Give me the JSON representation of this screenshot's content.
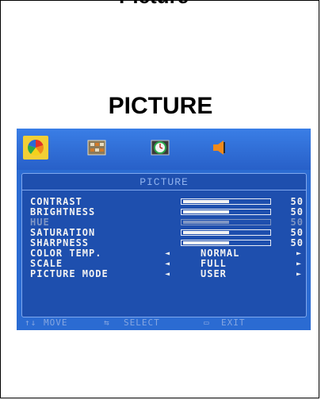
{
  "heading_cut": "Picture",
  "section_title": "PICTURE",
  "osd": {
    "tabs": [
      {
        "name": "picture",
        "icon": "color-wheel-icon",
        "active": true
      },
      {
        "name": "settings",
        "icon": "settings-grid-icon",
        "active": false
      },
      {
        "name": "time",
        "icon": "clock-icon",
        "active": false
      },
      {
        "name": "sound",
        "icon": "speaker-icon",
        "active": false
      }
    ],
    "panel_title": "PICTURE",
    "rows": [
      {
        "label": "CONTRAST",
        "value": "50",
        "level": 0.5
      },
      {
        "label": "BRIGHTNESS",
        "value": "50",
        "level": 0.5
      },
      {
        "label": "HUE",
        "value": "50",
        "level": 0.5,
        "disabled": true
      },
      {
        "label": "SATURATION",
        "value": "50",
        "level": 0.5
      },
      {
        "label": "SHARPNESS",
        "value": "50",
        "level": 0.5
      }
    ],
    "options": [
      {
        "label": "COLOR TEMP.",
        "value": "NORMAL"
      },
      {
        "label": "SCALE",
        "value": "FULL"
      },
      {
        "label": "PICTURE MODE",
        "value": "USER"
      }
    ],
    "footer": {
      "move": "MOVE",
      "select": "SELECT",
      "exit": "EXIT"
    },
    "colors": {
      "background": "#2b6bd2",
      "panel": "#1e4fae",
      "accent": "#f2cf35"
    }
  }
}
